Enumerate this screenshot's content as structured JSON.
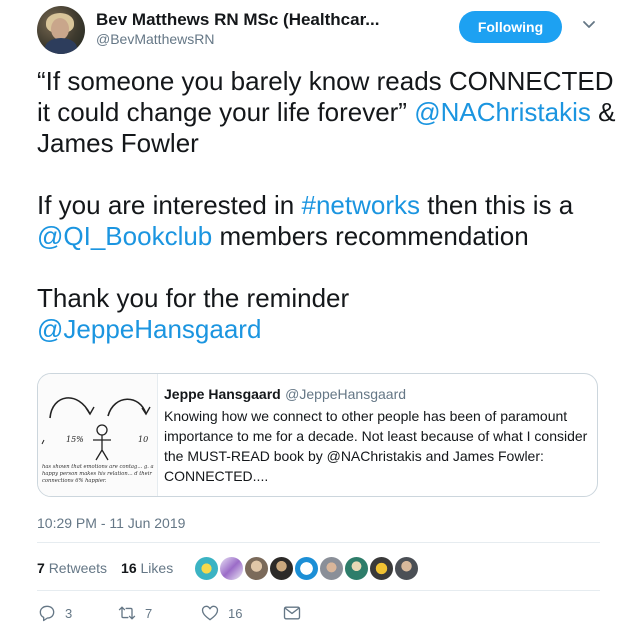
{
  "author": {
    "name": "Bev Matthews RN MSc (Healthcar...",
    "handle": "@BevMatthewsRN"
  },
  "follow_button": {
    "label": "Following"
  },
  "tweet": {
    "line1_a": "“If someone you barely know reads CONNECTED it could change your life forever” ",
    "mention1": "@NAChristakis",
    "line1_b": " & James Fowler",
    "line2_a": "If you are interested in ",
    "hashtag": "#networks",
    "line2_b": " then this is a ",
    "mention2": "@QI_Bookclub",
    "line2_c": " members recommendation",
    "line3": "Thank you for the reminder",
    "mention3": "@JeppeHansgaard"
  },
  "quoted_tweet": {
    "name": "Jeppe Hansgaard",
    "handle": "@JeppeHansgaard",
    "text": "Knowing how we connect to other people has been of paramount importance to me for a decade. Not least because of what I consider the MUST-READ book by @NAChristakis and James Fowler: CONNECTED....",
    "image": {
      "label_left": "15%",
      "label_right": "10",
      "caption": "has shown that emotions are contag... g. a happy person makes his relation... d their connections 6% happier."
    }
  },
  "timestamp": "10:29 PM - 11 Jun 2019",
  "stats": {
    "retweets_count": "7",
    "retweets_label": "Retweets",
    "likes_count": "16",
    "likes_label": "Likes"
  },
  "actions": {
    "replies": "3",
    "retweets": "7",
    "likes": "16"
  },
  "colors": {
    "accent": "#1da1f2",
    "link": "#1b95e0",
    "muted": "#657786",
    "border": "#e6ecf0"
  },
  "icons": [
    "chevron-down-icon",
    "reply-icon",
    "retweet-icon",
    "like-icon",
    "message-icon"
  ]
}
